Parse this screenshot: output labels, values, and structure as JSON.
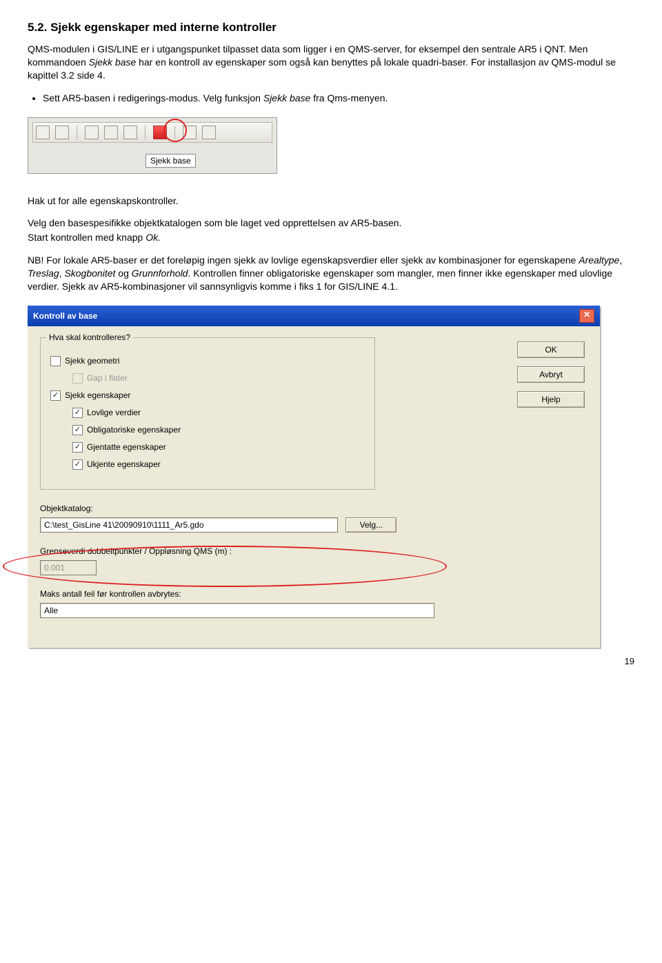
{
  "heading": "5.2. Sjekk egenskaper med interne kontroller",
  "para1_a": "QMS-modulen i GIS/LINE er i utgangspunket tilpasset data som ligger i en QMS-server, for eksempel den sentrale AR5 i QNT. Men kommandoen ",
  "para1_i": "Sjekk base",
  "para1_b": " har en kontroll av egenskaper som også kan benyttes på lokale quadri-baser. For installasjon av QMS-modul se kapittel 3.2 side 4.",
  "bullet_a": "Sett AR5-basen i redigerings-modus. Velg funksjon ",
  "bullet_i": "Sjekk base",
  "bullet_b": " fra Qms-menyen.",
  "tooltip": "Sjekk base",
  "para2": "Hak ut for alle egenskapskontroller.",
  "para3": "Velg den basespesifikke objektkatalogen som ble laget ved opprettelsen av AR5-basen.",
  "para4_a": "Start kontrollen med knapp ",
  "para4_i": "Ok.",
  "para5_a": "NB! For lokale AR5-baser er det foreløpig ingen sjekk av lovlige egenskapsverdier eller sjekk av kombinasjoner for egenskapene ",
  "para5_i1": "Arealtype",
  "para5_c1": ", ",
  "para5_i2": "Treslag",
  "para5_c2": ", ",
  "para5_i3": "Skogbonitet",
  "para5_c3": " og ",
  "para5_i4": "Grunnforhold",
  "para5_b": ". Kontrollen finner obligatoriske egenskaper som mangler, men finner ikke egenskaper med ulovlige verdier. Sjekk av AR5-kombinasjoner vil sannsynligvis komme i fiks 1 for GIS/LINE 4.1.",
  "dialog": {
    "title": "Kontroll av base",
    "group_title": "Hva skal kontrolleres?",
    "cb_geometri": "Sjekk geometri",
    "cb_gap": "Gap i flater",
    "cb_egenskaper": "Sjekk egenskaper",
    "cb_lovlige": "Lovlige verdier",
    "cb_oblig": "Obligatoriske egenskaper",
    "cb_gjentatte": "Gjentatte egenskaper",
    "cb_ukjente": "Ukjente egenskaper",
    "btn_ok": "OK",
    "btn_avbryt": "Avbryt",
    "btn_hjelp": "Hjelp",
    "objektkatalog_label": "Objektkatalog:",
    "objektkatalog_value": "C:\\test_GisLine 41\\20090910\\1111_Ar5.gdo",
    "velg": "Velg...",
    "grense_label": "Grenseverdi dobbeltpunkter / Oppløsning QMS (m) :",
    "grense_value": "0.001",
    "maks_label": "Maks antall feil før kontrollen avbrytes:",
    "maks_value": "Alle"
  },
  "pagenum": "19"
}
